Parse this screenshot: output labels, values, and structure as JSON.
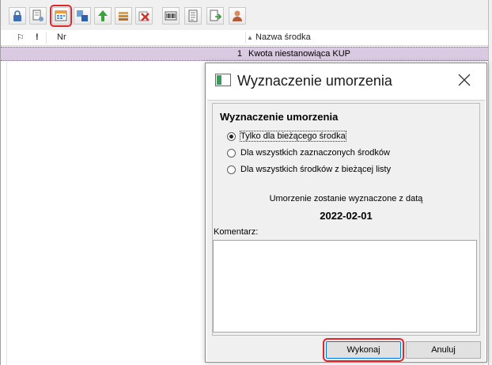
{
  "toolbar": {
    "buttons": [
      {
        "icon": "lock-icon"
      },
      {
        "icon": "document-settings-icon"
      },
      {
        "icon": "calculate-depreciation-icon",
        "highlighted": true
      },
      {
        "icon": "batch-number-icon"
      },
      {
        "icon": "upload-arrow-icon"
      },
      {
        "icon": "stack-icon"
      },
      {
        "icon": "delete-icon"
      },
      {
        "icon": "barcode-icon"
      },
      {
        "icon": "list-document-icon"
      },
      {
        "icon": "export-icon"
      },
      {
        "icon": "user-icon"
      }
    ]
  },
  "grid": {
    "columns": {
      "flag": "⚐",
      "priority": "!",
      "number": "Nr",
      "name": "Nazwa środka"
    },
    "rows": [
      {
        "number": "1",
        "name": "Kwota niestanowiąca KUP"
      }
    ]
  },
  "dialog": {
    "title": "Wyznaczenie umorzenia",
    "group_title": "Wyznaczenie umorzenia",
    "options": [
      {
        "label": "Tylko dla bieżącego środka",
        "selected": true
      },
      {
        "label": "Dla wszystkich zaznaczonych środków",
        "selected": false
      },
      {
        "label": "Dla wszystkich środków z bieżącej listy",
        "selected": false
      }
    ],
    "info_text": "Umorzenie zostanie wyznaczone z datą",
    "date": "2022-02-01",
    "comment_label": "Komentarz:",
    "comment_value": "",
    "buttons": {
      "ok": "Wykonaj",
      "cancel": "Anuluj"
    }
  },
  "colors": {
    "selected_row": "#d9c9e1",
    "highlight_outline": "#e0262a",
    "focus_border": "#0078d7"
  }
}
